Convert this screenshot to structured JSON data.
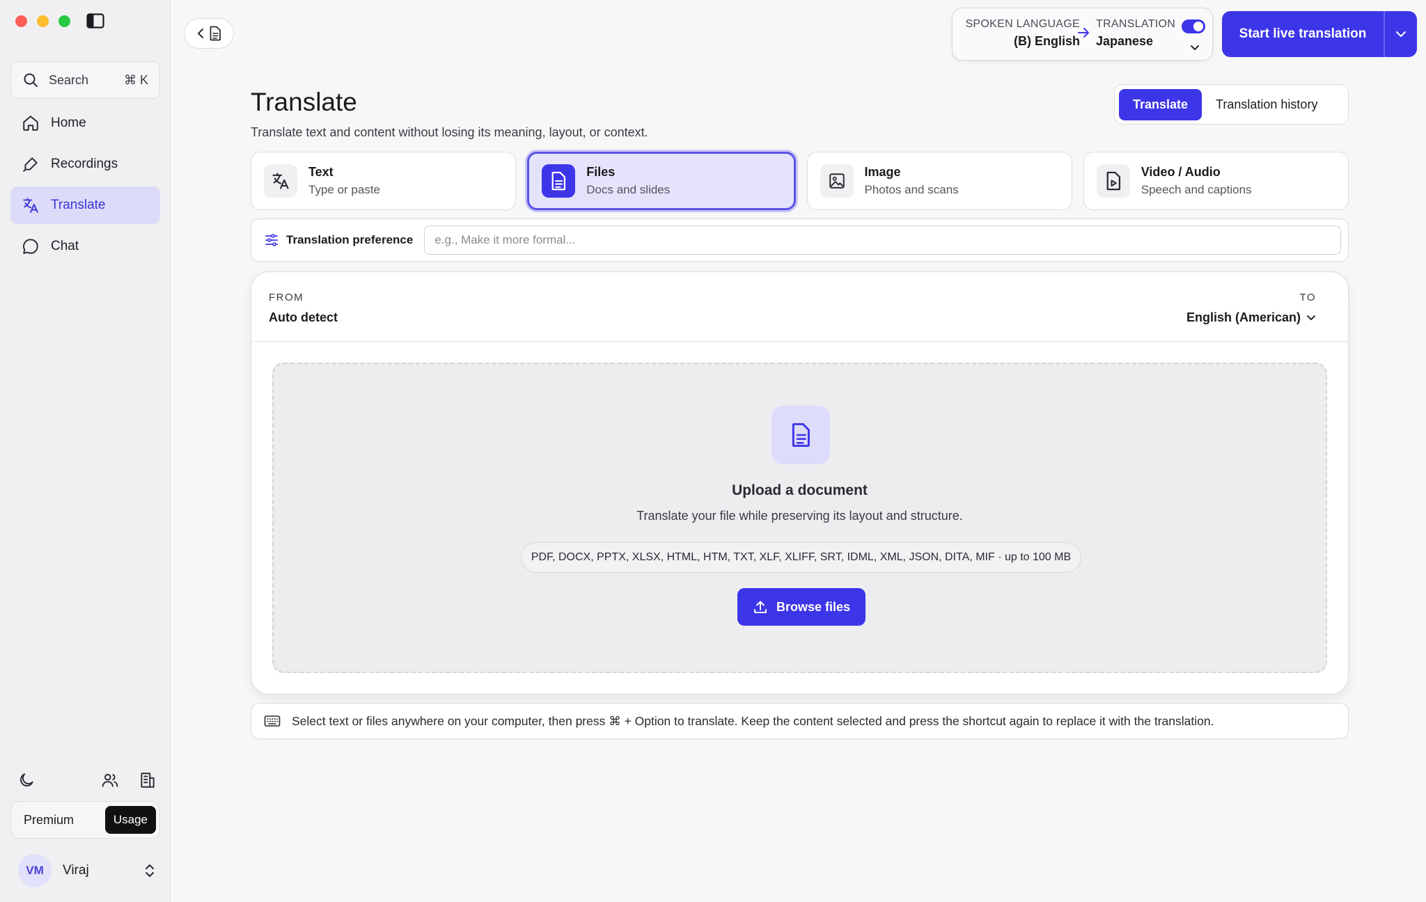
{
  "sidebar": {
    "search": {
      "label": "Search",
      "shortcut": "⌘ K"
    },
    "items": [
      {
        "label": "Home",
        "icon": "home-icon"
      },
      {
        "label": "Recordings",
        "icon": "pen-icon"
      },
      {
        "label": "Translate",
        "icon": "translate-icon",
        "active": true
      },
      {
        "label": "Chat",
        "icon": "chat-bubble-icon"
      }
    ],
    "plan": {
      "name": "Premium",
      "usage_label": "Usage"
    },
    "user": {
      "initials": "VM",
      "name": "Viraj"
    }
  },
  "topbar": {
    "spoken_language": {
      "label": "SPOKEN LANGUAGE",
      "value": "(B) English"
    },
    "translation": {
      "label": "TRANSLATION",
      "value": "Japanese",
      "enabled": true
    },
    "live_button": "Start live translation"
  },
  "page": {
    "title": "Translate",
    "subtitle": "Translate text and content without losing its meaning, layout, or context.",
    "tabs": [
      "Translate",
      "Translation history"
    ],
    "active_tab": "Translate"
  },
  "modes": [
    {
      "title": "Text",
      "subtitle": "Type or paste",
      "icon": "translate-icon"
    },
    {
      "title": "Files",
      "subtitle": "Docs and slides",
      "icon": "document-icon",
      "active": true
    },
    {
      "title": "Image",
      "subtitle": "Photos and scans",
      "icon": "image-icon"
    },
    {
      "title": "Video / Audio",
      "subtitle": "Speech and captions",
      "icon": "video-file-icon"
    }
  ],
  "preference": {
    "label": "Translation preference",
    "placeholder": "e.g., Make it more formal..."
  },
  "languages": {
    "from_label": "FROM",
    "from_value": "Auto detect",
    "to_label": "TO",
    "to_value": "English (American)"
  },
  "upload": {
    "title": "Upload a document",
    "subtitle": "Translate your file while preserving its layout and structure.",
    "formats": "PDF, DOCX, PPTX, XLSX, HTML, HTM, TXT, XLF, XLIFF, SRT, IDML, XML, JSON, DITA, MIF · up to 100 MB",
    "button": "Browse files"
  },
  "hint": "Select text or files anywhere on your computer, then press ⌘ + Option to translate. Keep the content selected and press the shortcut again to replace it with the translation.",
  "colors": {
    "accent": "#3d35e8",
    "accent_soft": "#e4e3fb"
  }
}
